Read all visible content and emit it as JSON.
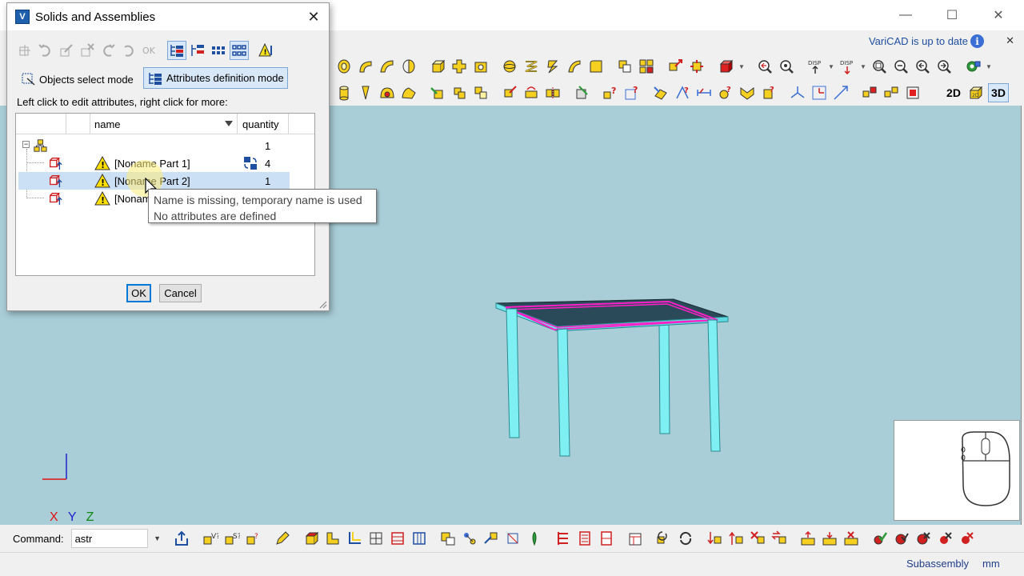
{
  "app": {
    "info_text": "VariCAD is up to date",
    "info_icon": "info-icon",
    "info_close": "✕",
    "window_controls": {
      "minimize": "—",
      "maximize": "☐",
      "close": "✕"
    }
  },
  "view_modes": {
    "mode_2d": "2D",
    "mode_2d_small": "2D",
    "mode_3d": "3D"
  },
  "viewport": {
    "background_color": "#a9ced8",
    "axis_x": "X",
    "axis_y": "Y",
    "axis_z": "Z"
  },
  "command_bar": {
    "label": "Command:",
    "value": "astr",
    "dropdown": "▼"
  },
  "status_bar": {
    "mode": "Subassembly",
    "units": "mm"
  },
  "dialog": {
    "title": "Solids and Assemblies",
    "close": "✕",
    "mode_objects": "Objects select mode",
    "mode_attributes": "Attributes definition mode",
    "hint": "Left click to edit attributes, right click for more:",
    "columns": {
      "name": "name",
      "quantity": "quantity"
    },
    "rows": [
      {
        "name": "",
        "quantity": "1",
        "type": "assembly"
      },
      {
        "name": "[Noname Part 1]",
        "quantity": "4",
        "type": "part",
        "linked": true
      },
      {
        "name": "[Noname Part 2]",
        "quantity": "1",
        "type": "part",
        "selected": true
      },
      {
        "name": "[Noname",
        "quantity": "",
        "type": "part"
      }
    ],
    "ok_label": "OK",
    "cancel_label": "Cancel"
  },
  "tooltip": {
    "line1": "Name is missing, temporary name is used",
    "line2": "No attributes are defined"
  }
}
